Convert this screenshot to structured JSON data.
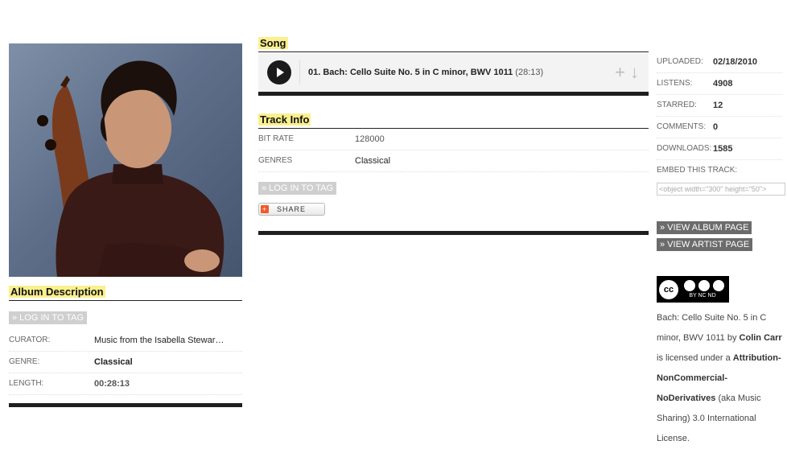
{
  "left": {
    "album_description_title": "Album Description",
    "login_to_tag": "» LOG IN TO TAG",
    "rows": [
      {
        "label": "CURATOR:",
        "value": "Music from the Isabella Stewar…"
      },
      {
        "label": "GENRE:",
        "value": "Classical"
      },
      {
        "label": "LENGTH:",
        "value": "00:28:13"
      }
    ]
  },
  "song": {
    "section_title": "Song",
    "track_title": "01. Bach: Cello Suite No. 5 in C minor, BWV 1011",
    "track_length": "(28:13)",
    "add_icon": "plus-icon",
    "download_icon": "download-arrow-icon"
  },
  "track_info": {
    "title": "Track Info",
    "rows": [
      {
        "label": "BIT RATE",
        "value": "128000"
      },
      {
        "label": "GENRES",
        "value": "Classical"
      }
    ],
    "login_to_tag": "» LOG IN TO TAG",
    "share_label": "SHARE"
  },
  "stats": {
    "rows": [
      {
        "label": "UPLOADED:",
        "value": "02/18/2010"
      },
      {
        "label": "LISTENS:",
        "value": "4908"
      },
      {
        "label": "STARRED:",
        "value": "12"
      },
      {
        "label": "COMMENTS:",
        "value": "0"
      },
      {
        "label": "DOWNLOADS:",
        "value": "1585"
      }
    ],
    "embed_label": "EMBED THIS TRACK:",
    "embed_value": "<object width=\"300\" height=\"50\">",
    "view_album": "» VIEW ALBUM PAGE",
    "view_artist": "» VIEW ARTIST PAGE"
  },
  "license": {
    "badge_text": "cc",
    "badge_sub": "BY  NC  ND",
    "work": "Bach: Cello Suite No. 5 in C minor, BWV 1011",
    "by": "by",
    "artist": "Colin Carr",
    "is_licensed": "is licensed under a",
    "license_name": "Attribution-NonCommercial-NoDerivatives",
    "aka": "(aka Music Sharing) 3.0 International License."
  }
}
